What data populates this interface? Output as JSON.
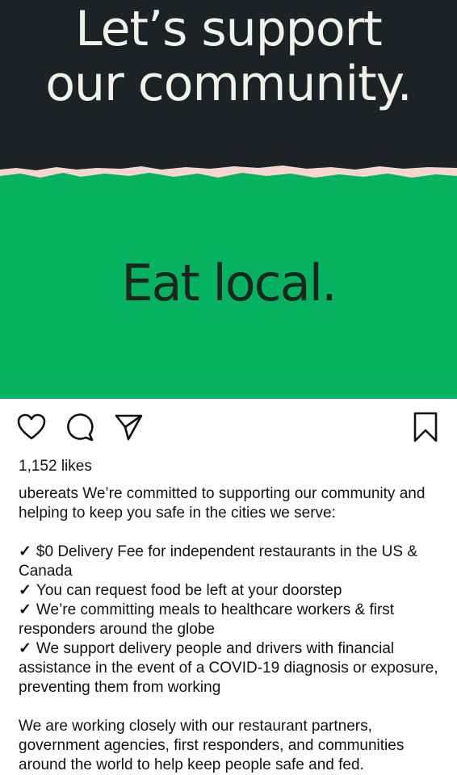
{
  "post": {
    "headline_line1": "Let’s support",
    "headline_line2": "our community.",
    "tagline": "Eat local.",
    "likes": "1,152 likes",
    "username": "ubereats",
    "caption_intro": "We’re committed to supporting our community and helping to keep you safe in the cities we serve:",
    "bullets": [
      "$0 Delivery Fee for independent restaurants in the US & Canada",
      "You can request food be left at your doorstep",
      "We’re committing meals to healthcare workers & first responders around the globe",
      "We support delivery people and drivers with financial assistance in the event of a COVID-19 diagnosis or exposure, preventing them from working"
    ],
    "check_glyph": "✓",
    "closing": "We are working closely with our restaurant partners, government agencies, first responders, and communities around the world to help keep people safe and fed."
  },
  "icons": [
    "heart-icon",
    "comment-icon",
    "share-icon",
    "bookmark-icon"
  ],
  "colors": {
    "dark_band": "#1c2226",
    "green_band": "#05b25f",
    "tear_edge": "#f7d6cf",
    "headline_text": "#f2f0ea",
    "tagline_text": "#1b2620"
  }
}
